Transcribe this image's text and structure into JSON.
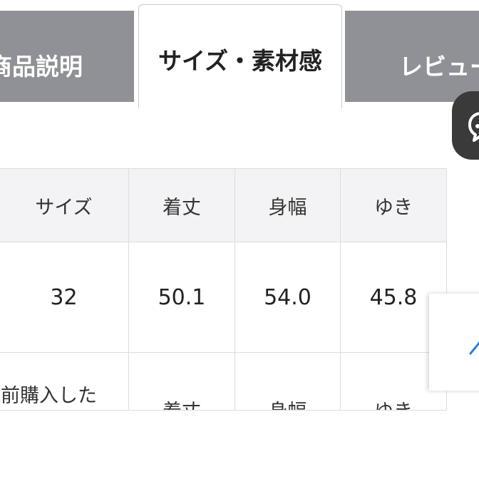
{
  "tabs": {
    "left_label": "商品説明",
    "active_label": "サイズ・素材感",
    "right_label": "レビュー"
  },
  "size_table": {
    "headers": [
      "サイズ",
      "着丈",
      "身幅",
      "ゆき"
    ],
    "rows": [
      [
        "32",
        "50.1",
        "54.0",
        "45.8"
      ]
    ],
    "next_row": [
      "前購入した",
      "着丈",
      "身幅",
      "ゆき"
    ]
  },
  "icons": {
    "chat_fab": "chat-bubble-icon",
    "arrow": "arrow-up-icon"
  },
  "colors": {
    "tab_inactive_bg": "#8f9196",
    "header_bg": "#f3f3f5",
    "border": "#dcdde2",
    "fab_bg": "#3a3a3a",
    "arrow": "#2d7fd0"
  }
}
